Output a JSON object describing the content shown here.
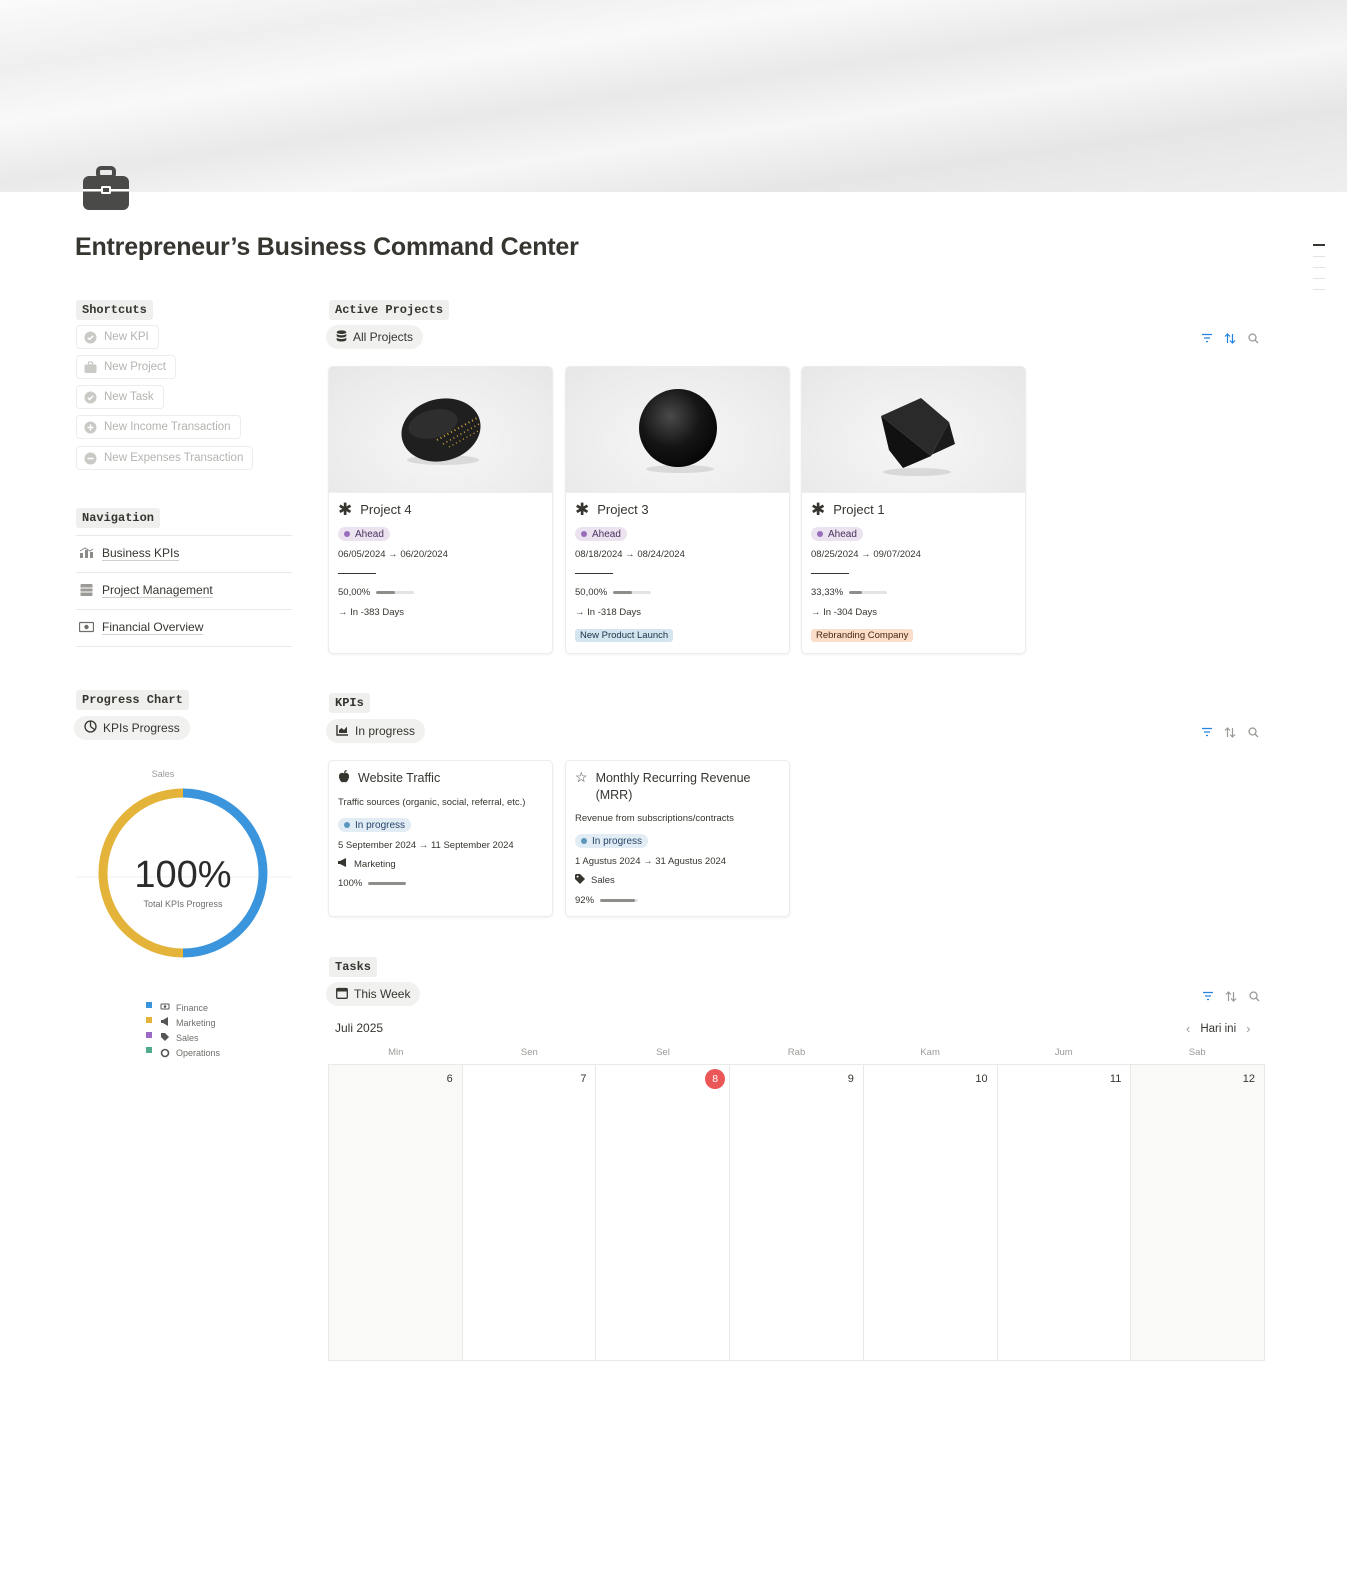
{
  "page": {
    "title": "Entrepreneur’s Business Command Center",
    "icon": "briefcase-icon"
  },
  "shortcuts": {
    "label": "Shortcuts",
    "items": [
      {
        "label": "New KPI",
        "icon": "check-circle-icon"
      },
      {
        "label": "New Project",
        "icon": "briefcase-icon"
      },
      {
        "label": "New Task",
        "icon": "check-circle-icon"
      },
      {
        "label": "New Income Transaction",
        "icon": "plus-circle-icon"
      },
      {
        "label": "New Expenses Transaction",
        "icon": "minus-circle-icon"
      }
    ]
  },
  "navigation": {
    "label": "Navigation",
    "items": [
      {
        "label": "Business KPIs",
        "icon": "chart-icon"
      },
      {
        "label": "Project Management",
        "icon": "cabinet-icon"
      },
      {
        "label": "Financial Overview",
        "icon": "money-icon"
      }
    ]
  },
  "progress_chart": {
    "label": "Progress Chart",
    "view": "KPIs Progress",
    "center_value": "100%",
    "center_label": "Total KPIs Progress",
    "top_label": "Sales",
    "legend": [
      {
        "name": "Finance",
        "color": "#3a95dd",
        "icon": "money-icon"
      },
      {
        "name": "Marketing",
        "color": "#e4b43a",
        "icon": "megaphone-icon"
      },
      {
        "name": "Sales",
        "color": "#9c6ac4",
        "icon": "tag-icon"
      },
      {
        "name": "Operations",
        "color": "#4fad8e",
        "icon": "gear-icon"
      }
    ]
  },
  "active_projects": {
    "label": "Active Projects",
    "view": "All Projects",
    "cards": [
      {
        "title": "Project 4",
        "status": "Ahead",
        "dates": "06/05/2024 → 06/20/2024",
        "progress": "50,00%",
        "progress_value": 0.5,
        "due": "→ In -383 Days",
        "tag": "",
        "shape": "disc"
      },
      {
        "title": "Project 3",
        "status": "Ahead",
        "dates": "08/18/2024 → 08/24/2024",
        "progress": "50,00%",
        "progress_value": 0.5,
        "due": "→ In -318 Days",
        "tag": "New Product Launch",
        "shape": "sphere"
      },
      {
        "title": "Project 1",
        "status": "Ahead",
        "dates": "08/25/2024 → 09/07/2024",
        "progress": "33,33%",
        "progress_value": 0.3333,
        "due": "→ In -304 Days",
        "tag": "Rebranding Company",
        "shape": "cube"
      }
    ]
  },
  "kpis": {
    "label": "KPIs",
    "view": "In progress",
    "cards": [
      {
        "title": "Website Traffic",
        "description": "Traffic sources (organic, social, referral, etc.)",
        "status": "In progress",
        "dates": "5 September 2024 → 11 September 2024",
        "category": "Marketing",
        "category_icon": "megaphone-icon",
        "progress": "100%",
        "progress_value": 1.0
      },
      {
        "title": "Monthly Recurring Revenue (MRR)",
        "description": "Revenue from subscriptions/contracts",
        "status": "In progress",
        "dates": "1 Agustus 2024 → 31 Agustus 2024",
        "category": "Sales",
        "category_icon": "tag-icon",
        "progress": "92%",
        "progress_value": 0.92
      }
    ]
  },
  "tasks": {
    "label": "Tasks",
    "view": "This Week",
    "month": "Juli 2025",
    "today_label": "Hari ini",
    "days_of_week": [
      "Min",
      "Sen",
      "Sel",
      "Rab",
      "Kam",
      "Jum",
      "Sab"
    ],
    "dates": [
      "6",
      "7",
      "8",
      "9",
      "10",
      "11",
      "12"
    ],
    "today": "8"
  },
  "colors": {
    "accent": "#2383e2",
    "today": "#eb5757",
    "ahead_dot": "#9a6dbc",
    "progress_dot": "#5b97bd"
  }
}
